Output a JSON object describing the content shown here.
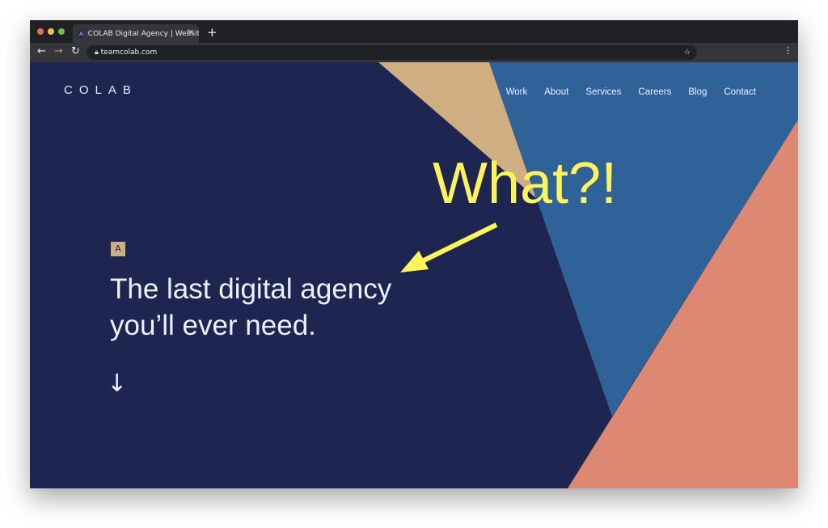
{
  "browser": {
    "tab_title": "COLAB Digital Agency | Website",
    "favicon_letter": "A",
    "url": "teamcolab.com"
  },
  "site": {
    "logo": "COLAB",
    "nav": [
      "Work",
      "About",
      "Services",
      "Careers",
      "Blog",
      "Contact"
    ],
    "badge": "A",
    "headline_line1": "The last digital agency",
    "headline_line2": "you’ll ever need.",
    "scroll_arrow": "↓"
  },
  "annotation": {
    "text": "What?!",
    "color": "#fdf35a"
  },
  "colors": {
    "navy": "#1e2551",
    "tan": "#cfae82",
    "blue": "#2f6299",
    "salmon": "#dc8872"
  }
}
